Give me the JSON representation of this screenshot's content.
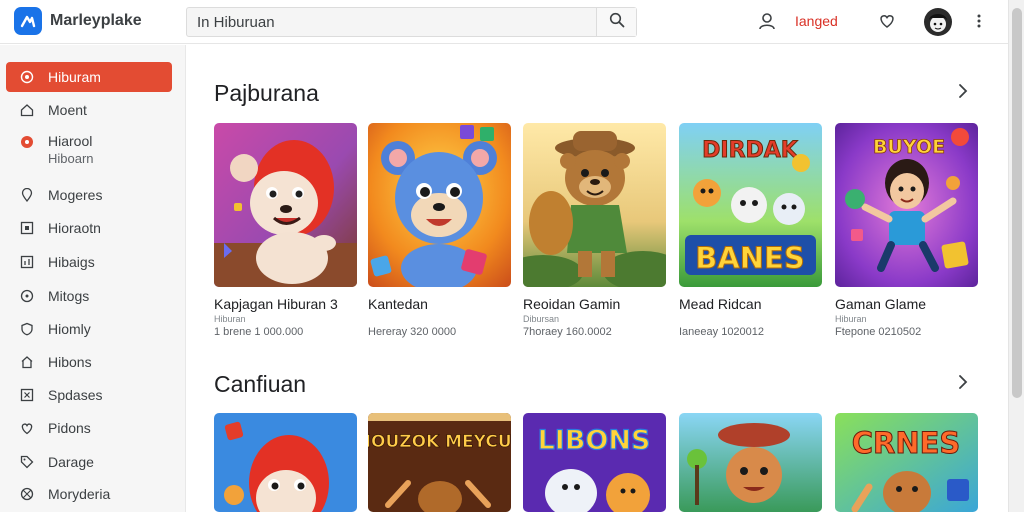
{
  "header": {
    "brand": "Marleyplake",
    "search_value": "In Hiburuan",
    "signin_label": "Ianged"
  },
  "sidebar": {
    "items": [
      {
        "label": "Hiburam",
        "icon": "games-icon",
        "active": true
      },
      {
        "label": "Moent",
        "icon": "home-icon"
      },
      {
        "label": "Hiarool",
        "label2": "Hiboarn",
        "icon": "apps-icon"
      },
      {
        "label": "Mogeres",
        "icon": "location-icon"
      },
      {
        "label": "Hioraotn",
        "icon": "square-icon"
      },
      {
        "label": "Hibaigs",
        "icon": "bar-chart-icon"
      },
      {
        "label": "Mitogs",
        "icon": "circle-dots-icon"
      },
      {
        "label": "Hiomly",
        "icon": "shield-icon"
      },
      {
        "label": "Hibons",
        "icon": "house-icon"
      },
      {
        "label": "Spdases",
        "icon": "close-box-icon"
      },
      {
        "label": "Pidons",
        "icon": "heart-icon"
      },
      {
        "label": "Darage",
        "icon": "tag-icon"
      },
      {
        "label": "Moryderia",
        "icon": "globe-icon"
      }
    ]
  },
  "sections": [
    {
      "title": "Pajburana",
      "cards": [
        {
          "title": "Kapjagan Hiburan 3",
          "sub": "Hiburan",
          "meta": "1 brene 1 000.000"
        },
        {
          "title": "Kantedan",
          "sub": "",
          "meta": "Hereray 320 0000"
        },
        {
          "title": "Reoidan Gamin",
          "sub": "Dibursan",
          "meta": "7horaey 160.0002"
        },
        {
          "title": "Mead Ridcan",
          "sub": "",
          "meta": "Ianeeay 1020012"
        },
        {
          "title": "Gaman Glame",
          "sub": "Hiburan",
          "meta": "Ftepone 0210502"
        }
      ]
    },
    {
      "title": "Canfiuan",
      "cards": [
        {
          "title": "",
          "sub": "",
          "meta": ""
        },
        {
          "title": "",
          "sub": "",
          "meta": ""
        },
        {
          "title": "",
          "sub": "",
          "meta": ""
        },
        {
          "title": "",
          "sub": "",
          "meta": ""
        },
        {
          "title": "",
          "sub": "",
          "meta": ""
        }
      ]
    }
  ],
  "thumbnails": {
    "logo_texts": [
      "DIRDAK",
      "BANES",
      "BUYOE",
      "MOUZOK MEYCUS",
      "LIBONS",
      "CRNES"
    ]
  },
  "colors": {
    "accent": "#e34c33",
    "brand": "#1a73e8",
    "signin": "#d93025"
  }
}
